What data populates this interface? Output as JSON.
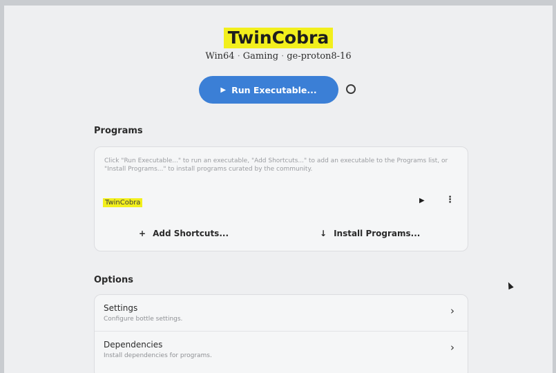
{
  "app": {
    "title": "TwinCobra",
    "subtitle": {
      "arch": "Win64",
      "category": "Gaming",
      "runner": "ge-proton8-16"
    },
    "run_button": {
      "label": "Run Executable...",
      "icon": "play-icon"
    },
    "status_icon": "circle-icon"
  },
  "programs": {
    "section_title": "Programs",
    "hint": "Click \"Run Executable...\" to run an executable, \"Add Shortcuts...\" to add an executable to the Programs list, or \"Install Programs...\" to install programs curated by the community.",
    "items": [
      {
        "name": "TwinCobra"
      }
    ],
    "actions": {
      "add_shortcuts": "Add Shortcuts...",
      "install_programs": "Install Programs..."
    }
  },
  "options": {
    "section_title": "Options",
    "items": [
      {
        "title": "Settings",
        "subtitle": "Configure bottle settings."
      },
      {
        "title": "Dependencies",
        "subtitle": "Install dependencies for programs."
      }
    ]
  },
  "colors": {
    "accent": "#3b7fd6",
    "highlight": "#f2ef1c"
  }
}
